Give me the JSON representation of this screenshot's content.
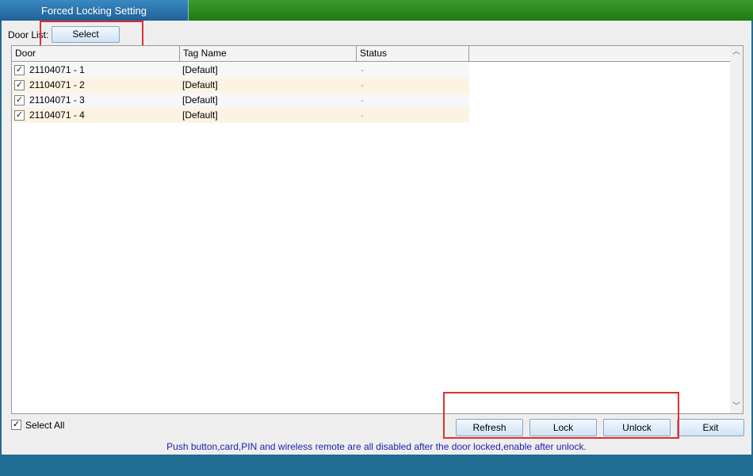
{
  "window": {
    "title": "Forced Locking Setting"
  },
  "door_list": {
    "label": "Door List:",
    "select_button": "Select"
  },
  "table": {
    "headers": {
      "door": "Door",
      "tag": "Tag Name",
      "status": "Status"
    },
    "rows": [
      {
        "checked": true,
        "door": "21104071 - 1",
        "tag": "[Default]",
        "status": "-"
      },
      {
        "checked": true,
        "door": "21104071 - 2",
        "tag": "[Default]",
        "status": "-"
      },
      {
        "checked": true,
        "door": "21104071 - 3",
        "tag": "[Default]",
        "status": "-"
      },
      {
        "checked": true,
        "door": "21104071 - 4",
        "tag": "[Default]",
        "status": "-"
      }
    ]
  },
  "select_all": {
    "label": "Select All",
    "checked": true
  },
  "buttons": {
    "refresh": "Refresh",
    "lock": "Lock",
    "unlock": "Unlock",
    "exit": "Exit"
  },
  "notice": "Push button,card,PIN and wireless remote are all disabled after the door locked,enable after unlock.",
  "colors": {
    "highlight": "#e03030",
    "notice_text": "#2020b0",
    "title_green": "#1f7a12",
    "title_blue": "#1e5f95"
  },
  "icons": {
    "checkbox": "check-mark",
    "scroll_up": "up-arrow",
    "scroll_down": "down-arrow"
  }
}
